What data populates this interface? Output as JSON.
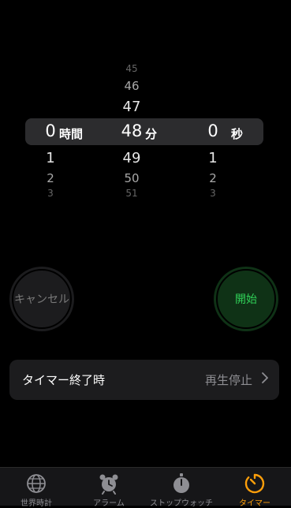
{
  "picker": {
    "hours": {
      "above": [],
      "selected": "0",
      "below": [
        "1",
        "2",
        "3"
      ],
      "unit": "時間"
    },
    "minutes": {
      "above": [
        "45",
        "46",
        "47"
      ],
      "selected": "48",
      "below": [
        "49",
        "50",
        "51"
      ],
      "unit": "分"
    },
    "seconds": {
      "above": [],
      "selected": "0",
      "below": [
        "1",
        "2",
        "3"
      ],
      "unit": "秒"
    }
  },
  "buttons": {
    "cancel": "キャンセル",
    "start": "開始"
  },
  "timer_end": {
    "label": "タイマー終了時",
    "value": "再生停止"
  },
  "tabs": [
    {
      "label": "世界時計",
      "icon": "globe-icon"
    },
    {
      "label": "アラーム",
      "icon": "alarm-clock-icon"
    },
    {
      "label": "ストップウォッチ",
      "icon": "stopwatch-icon"
    },
    {
      "label": "タイマー",
      "icon": "timer-icon",
      "active": true
    }
  ],
  "colors": {
    "accent": "#ff9f0a",
    "start_green": "#30d158",
    "start_bg": "#0f3216"
  }
}
